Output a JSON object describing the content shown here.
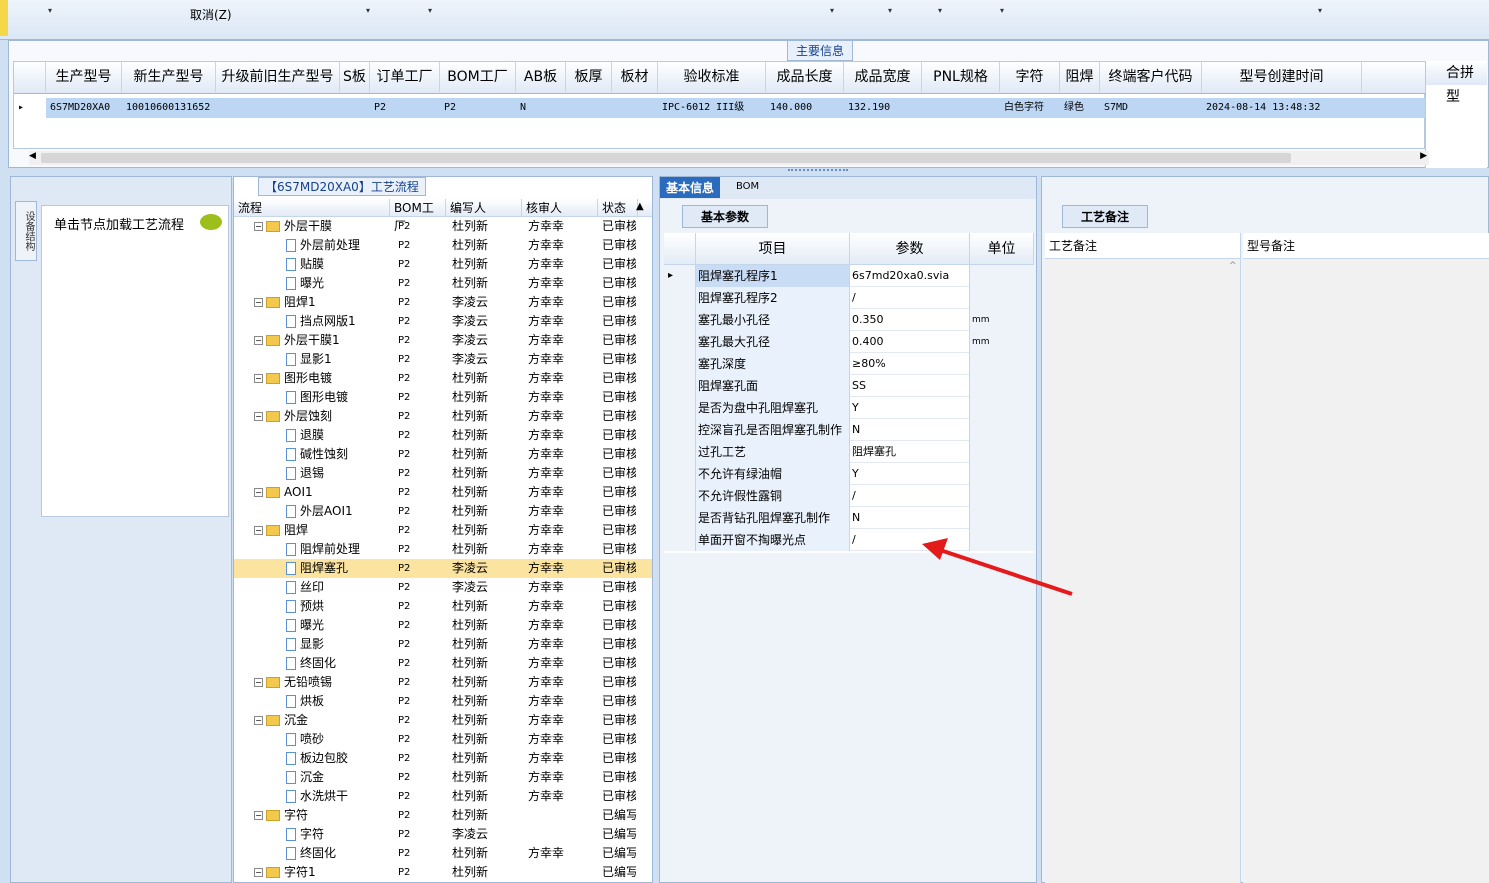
{
  "toolbar": {
    "cancel_label": "取消(Z)"
  },
  "main_info": {
    "section_title": "主要信息",
    "columns": [
      "生产型号",
      "新生产型号",
      "升级前旧生产型号",
      "S板",
      "订单工厂",
      "BOM工厂",
      "AB板",
      "板厚",
      "板材",
      "验收标准",
      "成品长度",
      "成品宽度",
      "PNL规格",
      "字符",
      "阻焊",
      "终端客户代码",
      "型号创建时间",
      "合拼型"
    ],
    "row": [
      "6S7MD20XA0",
      "10010600131652",
      "",
      "",
      "P2",
      "P2",
      "N",
      "",
      "",
      "IPC-6012 III级",
      "140.000",
      "132.190",
      "",
      "白色字符",
      "绿色",
      "S7MD",
      "2024-08-14 13:48:32",
      ""
    ]
  },
  "left_panel": {
    "vertical_tab": "设备结构",
    "loader_label": "单击节点加载工艺流程"
  },
  "process_panel": {
    "title": "【6S7MD20XA0】工艺流程",
    "headers": [
      "流程",
      "BOM工厂",
      "编写人",
      "核审人",
      "状态"
    ],
    "rows": [
      {
        "level": 1,
        "type": "folder",
        "name": "外层干膜",
        "bom": "P2",
        "writer": "杜列新",
        "reviewer": "方幸幸",
        "status": "已审核"
      },
      {
        "level": 2,
        "type": "doc",
        "name": "外层前处理",
        "bom": "P2",
        "writer": "杜列新",
        "reviewer": "方幸幸",
        "status": "已审核"
      },
      {
        "level": 2,
        "type": "doc",
        "name": "贴膜",
        "bom": "P2",
        "writer": "杜列新",
        "reviewer": "方幸幸",
        "status": "已审核"
      },
      {
        "level": 2,
        "type": "doc",
        "name": "曝光",
        "bom": "P2",
        "writer": "杜列新",
        "reviewer": "方幸幸",
        "status": "已审核"
      },
      {
        "level": 1,
        "type": "folder",
        "name": "阻焊1",
        "bom": "P2",
        "writer": "李凌云",
        "reviewer": "方幸幸",
        "status": "已审核"
      },
      {
        "level": 2,
        "type": "doc",
        "name": "挡点网版1",
        "bom": "P2",
        "writer": "李凌云",
        "reviewer": "方幸幸",
        "status": "已审核"
      },
      {
        "level": 1,
        "type": "folder",
        "name": "外层干膜1",
        "bom": "P2",
        "writer": "李凌云",
        "reviewer": "方幸幸",
        "status": "已审核"
      },
      {
        "level": 2,
        "type": "doc",
        "name": "显影1",
        "bom": "P2",
        "writer": "李凌云",
        "reviewer": "方幸幸",
        "status": "已审核"
      },
      {
        "level": 1,
        "type": "folder",
        "name": "图形电镀",
        "bom": "P2",
        "writer": "杜列新",
        "reviewer": "方幸幸",
        "status": "已审核"
      },
      {
        "level": 2,
        "type": "doc",
        "name": "图形电镀",
        "bom": "P2",
        "writer": "杜列新",
        "reviewer": "方幸幸",
        "status": "已审核"
      },
      {
        "level": 1,
        "type": "folder",
        "name": "外层蚀刻",
        "bom": "P2",
        "writer": "杜列新",
        "reviewer": "方幸幸",
        "status": "已审核"
      },
      {
        "level": 2,
        "type": "doc",
        "name": "退膜",
        "bom": "P2",
        "writer": "杜列新",
        "reviewer": "方幸幸",
        "status": "已审核"
      },
      {
        "level": 2,
        "type": "doc",
        "name": "碱性蚀刻",
        "bom": "P2",
        "writer": "杜列新",
        "reviewer": "方幸幸",
        "status": "已审核"
      },
      {
        "level": 2,
        "type": "doc",
        "name": "退锡",
        "bom": "P2",
        "writer": "杜列新",
        "reviewer": "方幸幸",
        "status": "已审核"
      },
      {
        "level": 1,
        "type": "folder",
        "name": "AOI1",
        "bom": "P2",
        "writer": "杜列新",
        "reviewer": "方幸幸",
        "status": "已审核"
      },
      {
        "level": 2,
        "type": "doc",
        "name": "外层AOI1",
        "bom": "P2",
        "writer": "杜列新",
        "reviewer": "方幸幸",
        "status": "已审核"
      },
      {
        "level": 1,
        "type": "folder",
        "name": "阻焊",
        "bom": "P2",
        "writer": "杜列新",
        "reviewer": "方幸幸",
        "status": "已审核"
      },
      {
        "level": 2,
        "type": "doc",
        "name": "阻焊前处理",
        "bom": "P2",
        "writer": "杜列新",
        "reviewer": "方幸幸",
        "status": "已审核"
      },
      {
        "level": 2,
        "type": "doc",
        "name": "阻焊塞孔",
        "bom": "P2",
        "writer": "李凌云",
        "reviewer": "方幸幸",
        "status": "已审核",
        "selected": true
      },
      {
        "level": 2,
        "type": "doc",
        "name": "丝印",
        "bom": "P2",
        "writer": "李凌云",
        "reviewer": "方幸幸",
        "status": "已审核"
      },
      {
        "level": 2,
        "type": "doc",
        "name": "预烘",
        "bom": "P2",
        "writer": "杜列新",
        "reviewer": "方幸幸",
        "status": "已审核"
      },
      {
        "level": 2,
        "type": "doc",
        "name": "曝光",
        "bom": "P2",
        "writer": "杜列新",
        "reviewer": "方幸幸",
        "status": "已审核"
      },
      {
        "level": 2,
        "type": "doc",
        "name": "显影",
        "bom": "P2",
        "writer": "杜列新",
        "reviewer": "方幸幸",
        "status": "已审核"
      },
      {
        "level": 2,
        "type": "doc",
        "name": "终固化",
        "bom": "P2",
        "writer": "杜列新",
        "reviewer": "方幸幸",
        "status": "已审核"
      },
      {
        "level": 1,
        "type": "folder",
        "name": "无铅喷锡",
        "bom": "P2",
        "writer": "杜列新",
        "reviewer": "方幸幸",
        "status": "已审核"
      },
      {
        "level": 2,
        "type": "doc",
        "name": "烘板",
        "bom": "P2",
        "writer": "杜列新",
        "reviewer": "方幸幸",
        "status": "已审核"
      },
      {
        "level": 1,
        "type": "folder",
        "name": "沉金",
        "bom": "P2",
        "writer": "杜列新",
        "reviewer": "方幸幸",
        "status": "已审核"
      },
      {
        "level": 2,
        "type": "doc",
        "name": "喷砂",
        "bom": "P2",
        "writer": "杜列新",
        "reviewer": "方幸幸",
        "status": "已审核"
      },
      {
        "level": 2,
        "type": "doc",
        "name": "板边包胶",
        "bom": "P2",
        "writer": "杜列新",
        "reviewer": "方幸幸",
        "status": "已审核"
      },
      {
        "level": 2,
        "type": "doc",
        "name": "沉金",
        "bom": "P2",
        "writer": "杜列新",
        "reviewer": "方幸幸",
        "status": "已审核"
      },
      {
        "level": 2,
        "type": "doc",
        "name": "水洗烘干",
        "bom": "P2",
        "writer": "杜列新",
        "reviewer": "方幸幸",
        "status": "已审核"
      },
      {
        "level": 1,
        "type": "folder",
        "name": "字符",
        "bom": "P2",
        "writer": "杜列新",
        "reviewer": "",
        "status": "已编写"
      },
      {
        "level": 2,
        "type": "doc",
        "name": "字符",
        "bom": "P2",
        "writer": "李凌云",
        "reviewer": "",
        "status": "已编写"
      },
      {
        "level": 2,
        "type": "doc",
        "name": "终固化",
        "bom": "P2",
        "writer": "杜列新",
        "reviewer": "方幸幸",
        "status": "已编写"
      },
      {
        "level": 1,
        "type": "folder",
        "name": "字符1",
        "bom": "P2",
        "writer": "杜列新",
        "reviewer": "",
        "status": "已编写"
      }
    ]
  },
  "basic_panel": {
    "tabs": [
      "基本信息",
      "BOM"
    ],
    "subtab": "基本参数",
    "headers": [
      "项目",
      "参数",
      "单位"
    ],
    "rows": [
      {
        "item": "阻焊塞孔程序1",
        "value": "6s7md20xa0.svia",
        "unit": ""
      },
      {
        "item": "阻焊塞孔程序2",
        "value": "/",
        "unit": ""
      },
      {
        "item": "塞孔最小孔径",
        "value": "0.350",
        "unit": "mm"
      },
      {
        "item": "塞孔最大孔径",
        "value": "0.400",
        "unit": "mm"
      },
      {
        "item": "塞孔深度",
        "value": "≥80%",
        "unit": ""
      },
      {
        "item": "阻焊塞孔面",
        "value": "SS",
        "unit": ""
      },
      {
        "item": "是否为盘中孔阻焊塞孔",
        "value": "Y",
        "unit": ""
      },
      {
        "item": "控深盲孔是否阻焊塞孔制作",
        "value": "N",
        "unit": ""
      },
      {
        "item": "过孔工艺",
        "value": "阻焊塞孔",
        "unit": ""
      },
      {
        "item": "不允许有绿油帽",
        "value": "Y",
        "unit": ""
      },
      {
        "item": "不允许假性露铜",
        "value": "/",
        "unit": ""
      },
      {
        "item": "是否背钻孔阻焊塞孔制作",
        "value": "N",
        "unit": ""
      },
      {
        "item": "单面开窗不掏曝光点",
        "value": "/",
        "unit": ""
      }
    ]
  },
  "remark_panel": {
    "title": "工艺备注",
    "col1": "工艺备注",
    "col2": "型号备注"
  },
  "colors": {
    "accent": "#2a6bbd",
    "selected_row": "#fbe3a0",
    "arrow": "#e31b1b"
  }
}
